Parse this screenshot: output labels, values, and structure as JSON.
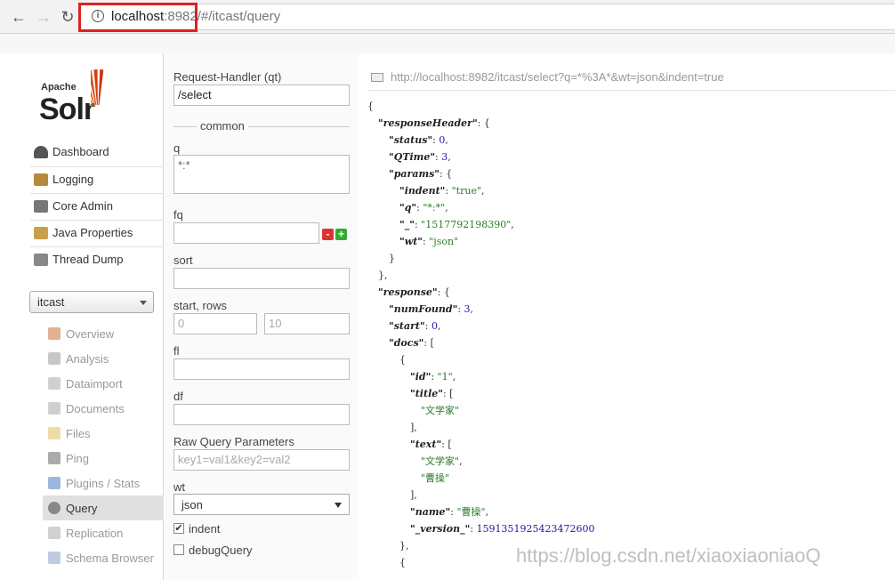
{
  "browser": {
    "url_host": "localhost",
    "url_port": ":8982",
    "url_path": "/#/itcast/query"
  },
  "logo": {
    "apache": "Apache",
    "solr": "Solr"
  },
  "sidebar": {
    "items": [
      {
        "label": "Dashboard",
        "icon": "dashboard-icon"
      },
      {
        "label": "Logging",
        "icon": "logging-icon"
      },
      {
        "label": "Core Admin",
        "icon": "core-admin-icon"
      },
      {
        "label": "Java Properties",
        "icon": "java-properties-icon"
      },
      {
        "label": "Thread Dump",
        "icon": "thread-dump-icon"
      }
    ],
    "core_selector": "itcast",
    "core_items": [
      {
        "label": "Overview",
        "icon": "home-icon"
      },
      {
        "label": "Analysis",
        "icon": "funnel-icon"
      },
      {
        "label": "Dataimport",
        "icon": "dataimport-icon"
      },
      {
        "label": "Documents",
        "icon": "documents-icon"
      },
      {
        "label": "Files",
        "icon": "folder-icon"
      },
      {
        "label": "Ping",
        "icon": "ping-icon"
      },
      {
        "label": "Plugins / Stats",
        "icon": "plugins-icon"
      },
      {
        "label": "Query",
        "icon": "magnifier-icon"
      },
      {
        "label": "Replication",
        "icon": "replication-icon"
      },
      {
        "label": "Schema Browser",
        "icon": "schema-icon"
      }
    ]
  },
  "form": {
    "qt_label": "Request-Handler (qt)",
    "qt_value": "/select",
    "common_label": "common",
    "q_label": "q",
    "q_value": "*:*",
    "fq_label": "fq",
    "fq_remove": "-",
    "fq_add": "+",
    "sort_label": "sort",
    "start_rows_label": "start, rows",
    "start_placeholder": "0",
    "rows_placeholder": "10",
    "fl_label": "fl",
    "df_label": "df",
    "raw_label": "Raw Query Parameters",
    "raw_placeholder": "key1=val1&key2=val2",
    "wt_label": "wt",
    "wt_value": "json",
    "indent_label": "indent",
    "indent_checked": "✔",
    "debug_label": "debugQuery"
  },
  "result": {
    "request_url": "http://localhost:8982/itcast/select?q=*%3A*&wt=json&indent=true"
  },
  "json_lines": [
    {
      "i": 0,
      "parts": [
        {
          "t": "p",
          "v": "{"
        }
      ]
    },
    {
      "i": 1,
      "parts": [
        {
          "t": "k",
          "v": "\"responseHeader\""
        },
        {
          "t": "p",
          "v": ": {"
        }
      ]
    },
    {
      "i": 2,
      "parts": [
        {
          "t": "k",
          "v": "\"status\""
        },
        {
          "t": "p",
          "v": ": "
        },
        {
          "t": "n",
          "v": "0"
        },
        {
          "t": "p",
          "v": ","
        }
      ]
    },
    {
      "i": 2,
      "parts": [
        {
          "t": "k",
          "v": "\"QTime\""
        },
        {
          "t": "p",
          "v": ": "
        },
        {
          "t": "n",
          "v": "3"
        },
        {
          "t": "p",
          "v": ","
        }
      ]
    },
    {
      "i": 2,
      "parts": [
        {
          "t": "k",
          "v": "\"params\""
        },
        {
          "t": "p",
          "v": ": {"
        }
      ]
    },
    {
      "i": 3,
      "parts": [
        {
          "t": "k",
          "v": "\"indent\""
        },
        {
          "t": "p",
          "v": ": "
        },
        {
          "t": "s",
          "v": "\"true\""
        },
        {
          "t": "p",
          "v": ","
        }
      ]
    },
    {
      "i": 3,
      "parts": [
        {
          "t": "k",
          "v": "\"q\""
        },
        {
          "t": "p",
          "v": ": "
        },
        {
          "t": "s",
          "v": "\"*:*\""
        },
        {
          "t": "p",
          "v": ","
        }
      ]
    },
    {
      "i": 3,
      "parts": [
        {
          "t": "k",
          "v": "\"_\""
        },
        {
          "t": "p",
          "v": ": "
        },
        {
          "t": "s",
          "v": "\"1517792198390\""
        },
        {
          "t": "p",
          "v": ","
        }
      ]
    },
    {
      "i": 3,
      "parts": [
        {
          "t": "k",
          "v": "\"wt\""
        },
        {
          "t": "p",
          "v": ": "
        },
        {
          "t": "s",
          "v": "\"json\""
        }
      ]
    },
    {
      "i": 2,
      "parts": [
        {
          "t": "p",
          "v": "}"
        }
      ]
    },
    {
      "i": 1,
      "parts": [
        {
          "t": "p",
          "v": "},"
        }
      ]
    },
    {
      "i": 1,
      "parts": [
        {
          "t": "k",
          "v": "\"response\""
        },
        {
          "t": "p",
          "v": ": {"
        }
      ]
    },
    {
      "i": 2,
      "parts": [
        {
          "t": "k",
          "v": "\"numFound\""
        },
        {
          "t": "p",
          "v": ": "
        },
        {
          "t": "n",
          "v": "3"
        },
        {
          "t": "p",
          "v": ","
        }
      ]
    },
    {
      "i": 2,
      "parts": [
        {
          "t": "k",
          "v": "\"start\""
        },
        {
          "t": "p",
          "v": ": "
        },
        {
          "t": "n",
          "v": "0"
        },
        {
          "t": "p",
          "v": ","
        }
      ]
    },
    {
      "i": 2,
      "parts": [
        {
          "t": "k",
          "v": "\"docs\""
        },
        {
          "t": "p",
          "v": ": ["
        }
      ]
    },
    {
      "i": 3,
      "parts": [
        {
          "t": "p",
          "v": "{"
        }
      ]
    },
    {
      "i": 4,
      "parts": [
        {
          "t": "k",
          "v": "\"id\""
        },
        {
          "t": "p",
          "v": ": "
        },
        {
          "t": "s",
          "v": "\"1\""
        },
        {
          "t": "p",
          "v": ","
        }
      ]
    },
    {
      "i": 4,
      "parts": [
        {
          "t": "k",
          "v": "\"title\""
        },
        {
          "t": "p",
          "v": ": ["
        }
      ]
    },
    {
      "i": 5,
      "parts": [
        {
          "t": "s",
          "v": "\"文学家\""
        }
      ]
    },
    {
      "i": 4,
      "parts": [
        {
          "t": "p",
          "v": "],"
        }
      ]
    },
    {
      "i": 4,
      "parts": [
        {
          "t": "k",
          "v": "\"text\""
        },
        {
          "t": "p",
          "v": ": ["
        }
      ]
    },
    {
      "i": 5,
      "parts": [
        {
          "t": "s",
          "v": "\"文学家\""
        },
        {
          "t": "p",
          "v": ","
        }
      ]
    },
    {
      "i": 5,
      "parts": [
        {
          "t": "s",
          "v": "\"曹操\""
        }
      ]
    },
    {
      "i": 4,
      "parts": [
        {
          "t": "p",
          "v": "],"
        }
      ]
    },
    {
      "i": 4,
      "parts": [
        {
          "t": "k",
          "v": "\"name\""
        },
        {
          "t": "p",
          "v": ": "
        },
        {
          "t": "s",
          "v": "\"曹操\""
        },
        {
          "t": "p",
          "v": ","
        }
      ]
    },
    {
      "i": 4,
      "parts": [
        {
          "t": "k",
          "v": "\"_version_\""
        },
        {
          "t": "p",
          "v": ": "
        },
        {
          "t": "n",
          "v": "1591351925423472600"
        }
      ]
    },
    {
      "i": 3,
      "parts": [
        {
          "t": "p",
          "v": "},"
        }
      ]
    },
    {
      "i": 3,
      "parts": [
        {
          "t": "p",
          "v": "{"
        }
      ]
    }
  ],
  "watermark": "https://blog.csdn.net/xiaoxiaoniaoQ",
  "colors": {
    "highlight": "#e02020",
    "key": "#222222",
    "string": "#2a7a2a",
    "number": "#1a1aa6"
  }
}
